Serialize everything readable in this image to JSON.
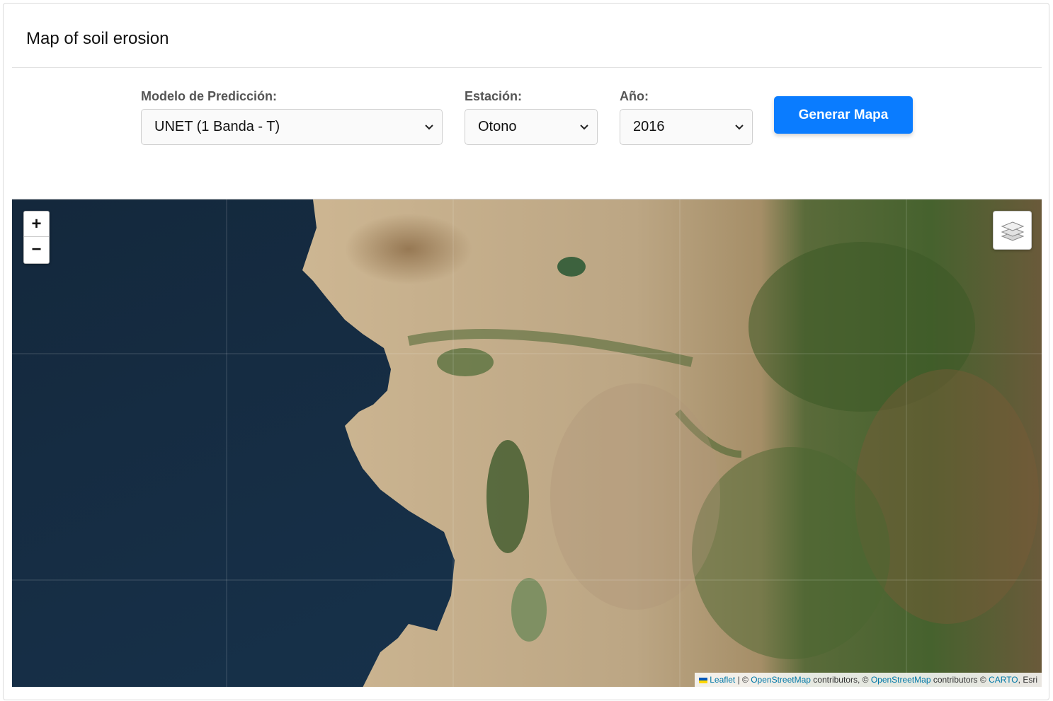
{
  "header": {
    "title": "Map of soil erosion"
  },
  "controls": {
    "model": {
      "label": "Modelo de Predicción:",
      "value": "UNET (1 Banda - T)"
    },
    "season": {
      "label": "Estación:",
      "value": "Otono"
    },
    "year": {
      "label": "Año:",
      "value": "2016"
    },
    "generate_label": "Generar Mapa"
  },
  "map": {
    "zoom_in": "+",
    "zoom_out": "−",
    "layers_icon": "layers-icon",
    "attribution": {
      "leaflet": "Leaflet",
      "sep1": " | © ",
      "osm1": "OpenStreetMap",
      "text1": " contributors, © ",
      "osm2": "OpenStreetMap",
      "text2": " contributors © ",
      "carto": "CARTO",
      "text3": ", Esri"
    },
    "colors": {
      "ocean": "#17314a",
      "desert": "#c9b08a",
      "forest": "#4f6b33",
      "accent": "#0a7cff"
    }
  }
}
